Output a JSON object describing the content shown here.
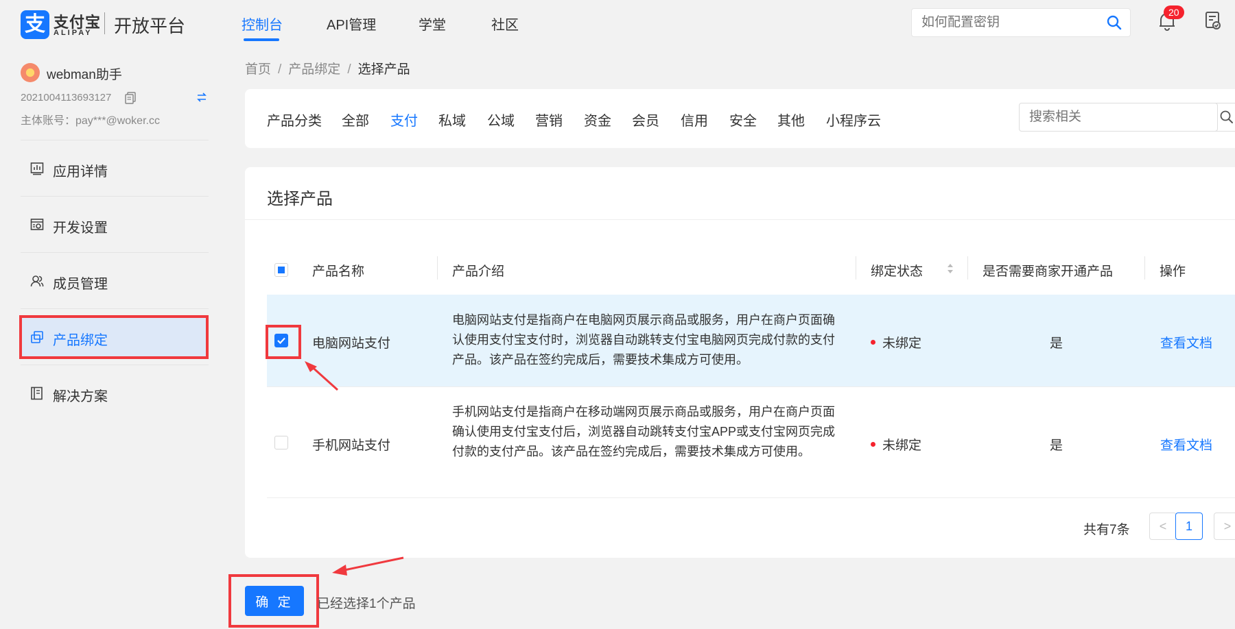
{
  "header": {
    "logo_cn": "支付宝",
    "logo_en": "ALIPAY",
    "platform": "开放平台",
    "nav": [
      "控制台",
      "API管理",
      "学堂",
      "社区"
    ],
    "active_nav": "控制台",
    "search_placeholder": "如何配置密钥",
    "notification_count": "20"
  },
  "sidebar": {
    "app_name": "webman助手",
    "app_id": "2021004113693127",
    "main_account": "主体账号：pay***@woker.cc",
    "items": [
      {
        "label": "应用详情",
        "icon": "chart-icon"
      },
      {
        "label": "开发设置",
        "icon": "settings-icon"
      },
      {
        "label": "成员管理",
        "icon": "members-icon"
      },
      {
        "label": "产品绑定",
        "icon": "link-icon",
        "active": true
      },
      {
        "label": "解决方案",
        "icon": "book-icon"
      }
    ]
  },
  "breadcrumb": {
    "items": [
      "首页",
      "产品绑定"
    ],
    "separator": "/",
    "current": "选择产品"
  },
  "categories": {
    "label": "产品分类",
    "items": [
      "全部",
      "支付",
      "私域",
      "公域",
      "营销",
      "资金",
      "会员",
      "信用",
      "安全",
      "其他",
      "小程序云"
    ],
    "active": "支付",
    "search_placeholder": "搜索相关"
  },
  "panel": {
    "title": "选择产品",
    "columns": [
      "产品名称",
      "产品介绍",
      "绑定状态",
      "是否需要商家开通产品",
      "操作"
    ],
    "rows": [
      {
        "name": "电脑网站支付",
        "description": "电脑网站支付是指商户在电脑网页展示商品或服务，用户在商户页面确认使用支付宝支付时，浏览器自动跳转支付宝电脑网页完成付款的支付产品。该产品在签约完成后，需要技术集成方可使用。",
        "status": "未绑定",
        "merchant_required": "是",
        "action": "查看文档",
        "checked": true
      },
      {
        "name": "手机网站支付",
        "description": "手机网站支付是指商户在移动端网页展示商品或服务，用户在商户页面确认使用支付宝支付后，浏览器自动跳转支付宝APP或支付宝网页完成付款的支付产品。该产品在签约完成后，需要技术集成方可使用。",
        "status": "未绑定",
        "merchant_required": "是",
        "action": "查看文档",
        "checked": false
      }
    ],
    "pagination": {
      "total": "共有7条",
      "current_page": "1",
      "prev": "<",
      "next": ">"
    }
  },
  "footer": {
    "confirm": "确 定",
    "selected_note": "已经选择1个产品"
  },
  "colors": {
    "brand": "#1677ff",
    "highlight_row": "#e6f4fd",
    "status_dot": "#f5222d",
    "annotation": "#f0393e"
  }
}
